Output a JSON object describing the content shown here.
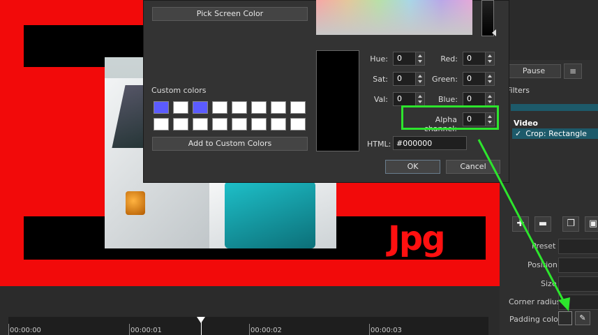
{
  "dialog": {
    "pick_screen_color": "Pick Screen Color",
    "custom_colors_label": "Custom colors",
    "add_custom_colors": "Add to Custom Colors",
    "custom_swatches": [
      "#5b5bff",
      "#ffffff",
      "#5b5bff",
      "#ffffff",
      "#ffffff",
      "#ffffff",
      "#ffffff",
      "#ffffff",
      "#ffffff",
      "#ffffff",
      "#ffffff",
      "#ffffff",
      "#ffffff",
      "#ffffff",
      "#ffffff",
      "#ffffff"
    ],
    "current_color": "#000000",
    "fields": {
      "hue": {
        "label": "Hue:",
        "value": "0"
      },
      "sat": {
        "label": "Sat:",
        "value": "0"
      },
      "val": {
        "label": "Val:",
        "value": "0"
      },
      "red": {
        "label": "Red:",
        "value": "0"
      },
      "green": {
        "label": "Green:",
        "value": "0"
      },
      "blue": {
        "label": "Blue:",
        "value": "0"
      },
      "alpha": {
        "label": "Alpha channel:",
        "value": "0"
      }
    },
    "html_label": "HTML:",
    "html_value": "#000000",
    "ok": "OK",
    "cancel": "Cancel"
  },
  "side_panel": {
    "pause": "Pause",
    "menu_icon": "≡",
    "filters": "Filters",
    "video_group": "Video",
    "filter_item": "Crop: Rectangle",
    "properties": {
      "preset": "Preset",
      "position": "Position",
      "size": "Size",
      "corner_radius": "Corner radius",
      "padding_color": "Padding color"
    }
  },
  "preview": {
    "logo_text": "Jpg"
  },
  "timeline": {
    "ticks": [
      "00:00:00",
      "00:00:01",
      "00:00:02",
      "00:00:03"
    ]
  },
  "highlight_color": "#2de52d"
}
